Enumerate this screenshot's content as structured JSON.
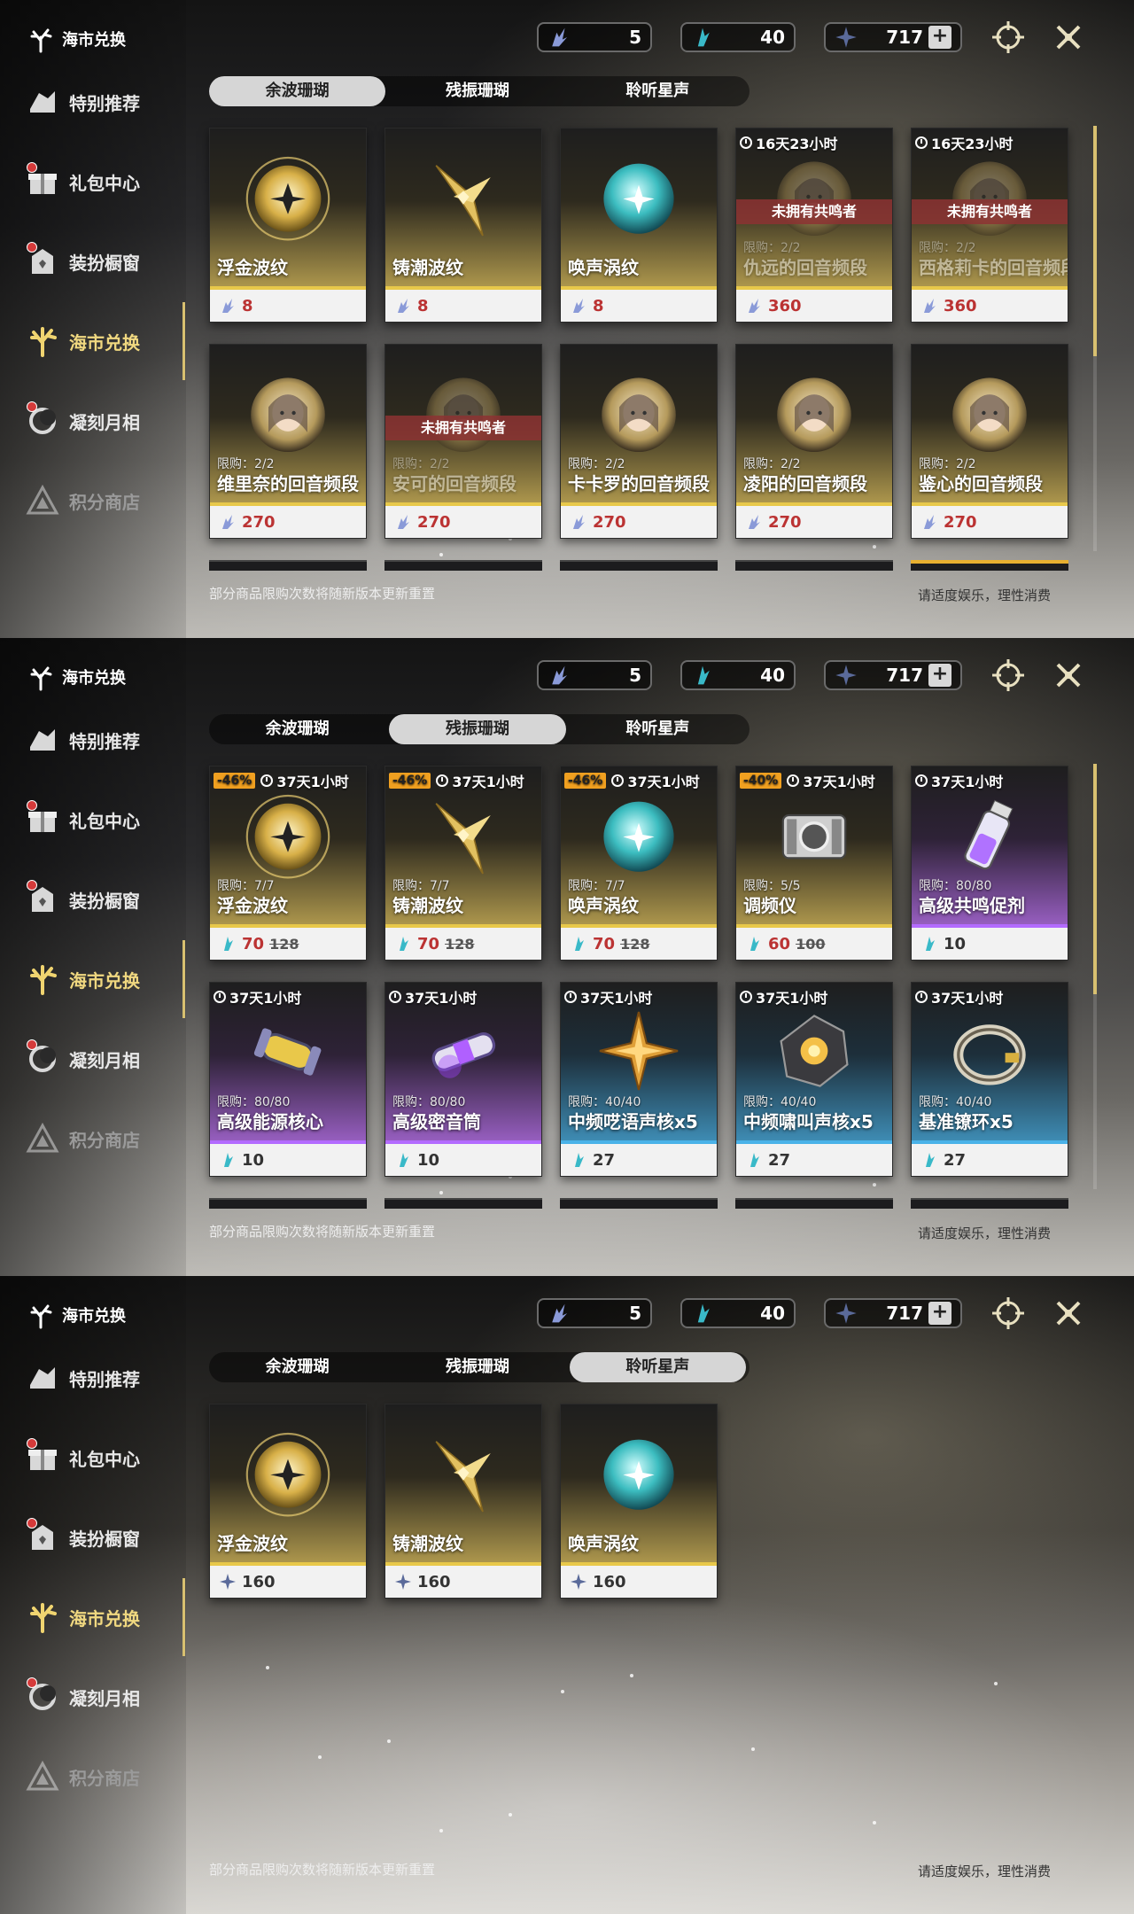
{
  "brand": {
    "title": "海市兑换"
  },
  "sidebar": {
    "items": [
      {
        "label": "特别推荐"
      },
      {
        "label": "礼包中心"
      },
      {
        "label": "装扮橱窗"
      },
      {
        "label": "海市兑换"
      },
      {
        "label": "凝刻月相"
      },
      {
        "label": "积分商店"
      }
    ]
  },
  "currencies": [
    {
      "icon": "wave-coral-icon",
      "value": "5"
    },
    {
      "icon": "resonance-coral-icon",
      "value": "40"
    },
    {
      "icon": "star-voice-icon",
      "value": "717"
    }
  ],
  "plus_label": "+",
  "tabs": [
    {
      "label": "余波珊瑚"
    },
    {
      "label": "残振珊瑚"
    },
    {
      "label": "聆听星声"
    }
  ],
  "footer": {
    "note": "部分商品限购次数将随新版本更新重置",
    "right": "请适度娱乐，理性消费"
  },
  "panel1": {
    "active_tab": 0,
    "cards": [
      {
        "name": "浮金波纹",
        "price": "8",
        "theme": "gold",
        "art": "golden-orb-icon"
      },
      {
        "name": "铸潮波纹",
        "price": "8",
        "theme": "gold",
        "art": "golden-blade-icon"
      },
      {
        "name": "唤声涡纹",
        "price": "8",
        "theme": "gold",
        "art": "cyan-orb-icon"
      },
      {
        "name": "仇远的回音频段",
        "price": "360",
        "theme": "gold",
        "timer": "16天23小时",
        "limit": "限购：2/2",
        "unowned": "未拥有共鸣者",
        "art": "character-portrait-icon"
      },
      {
        "name": "西格莉卡的回音频段",
        "price": "360",
        "theme": "gold",
        "timer": "16天23小时",
        "limit": "限购：2/2",
        "unowned": "未拥有共鸣者",
        "art": "character-portrait-icon"
      },
      {
        "name": "维里奈的回音频段",
        "price": "270",
        "theme": "gold",
        "limit": "限购：2/2",
        "art": "character-portrait-icon"
      },
      {
        "name": "安可的回音频段",
        "price": "270",
        "theme": "gold",
        "limit": "限购：2/2",
        "unowned": "未拥有共鸣者",
        "art": "character-portrait-icon"
      },
      {
        "name": "卡卡罗的回音频段",
        "price": "270",
        "theme": "gold",
        "limit": "限购：2/2",
        "art": "character-portrait-icon"
      },
      {
        "name": "凌阳的回音频段",
        "price": "270",
        "theme": "gold",
        "limit": "限购：2/2",
        "art": "character-portrait-icon"
      },
      {
        "name": "鉴心的回音频段",
        "price": "270",
        "theme": "gold",
        "limit": "限购：2/2",
        "art": "character-portrait-icon"
      }
    ]
  },
  "panel2": {
    "active_tab": 1,
    "cards": [
      {
        "name": "浮金波纹",
        "price": "70",
        "old_price": "128",
        "discount": "-46%",
        "timer": "37天1小时",
        "limit": "限购：7/7",
        "theme": "gold",
        "art": "golden-orb-icon"
      },
      {
        "name": "铸潮波纹",
        "price": "70",
        "old_price": "128",
        "discount": "-46%",
        "timer": "37天1小时",
        "limit": "限购：7/7",
        "theme": "gold",
        "art": "golden-blade-icon"
      },
      {
        "name": "唤声涡纹",
        "price": "70",
        "old_price": "128",
        "discount": "-46%",
        "timer": "37天1小时",
        "limit": "限购：7/7",
        "theme": "gold",
        "art": "cyan-orb-icon"
      },
      {
        "name": "调频仪",
        "price": "60",
        "old_price": "100",
        "discount": "-40%",
        "timer": "37天1小时",
        "limit": "限购：5/5",
        "theme": "gold",
        "art": "tuner-device-icon"
      },
      {
        "name": "高级共鸣促剂",
        "price": "10",
        "timer": "37天1小时",
        "limit": "限购：80/80",
        "theme": "purple",
        "art": "vial-icon"
      },
      {
        "name": "高级能源核心",
        "price": "10",
        "timer": "37天1小时",
        "limit": "限购：80/80",
        "theme": "purple",
        "art": "energy-core-icon"
      },
      {
        "name": "高级密音筒",
        "price": "10",
        "timer": "37天1小时",
        "limit": "限购：80/80",
        "theme": "purple",
        "art": "sealed-tube-icon"
      },
      {
        "name": "中频呓语声核x5",
        "price": "27",
        "timer": "37天1小时",
        "limit": "限购：40/40",
        "theme": "blue",
        "art": "star-core-icon"
      },
      {
        "name": "中频啸叫声核x5",
        "price": "27",
        "timer": "37天1小时",
        "limit": "限购：40/40",
        "theme": "blue",
        "art": "orb-core-icon"
      },
      {
        "name": "基准镣环x5",
        "price": "27",
        "timer": "37天1小时",
        "limit": "限购：40/40",
        "theme": "blue",
        "art": "ring-icon"
      }
    ]
  },
  "panel3": {
    "active_tab": 2,
    "cards": [
      {
        "name": "浮金波纹",
        "price": "160",
        "theme": "gold",
        "art": "golden-orb-icon"
      },
      {
        "name": "铸潮波纹",
        "price": "160",
        "theme": "gold",
        "art": "golden-blade-icon"
      },
      {
        "name": "唤声涡纹",
        "price": "160",
        "theme": "gold",
        "art": "cyan-orb-icon"
      }
    ]
  },
  "colors": {
    "accent": "#d8c070",
    "price_red": "#b33333",
    "unowned": "#8c3232",
    "discount": "#f0a020"
  }
}
